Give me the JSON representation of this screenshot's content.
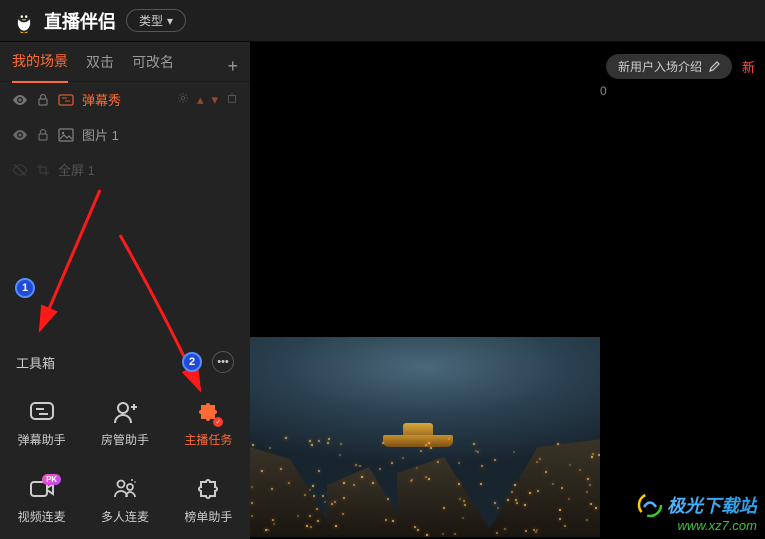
{
  "app": {
    "title": "直播伴侣",
    "dropdown": "类型"
  },
  "tabs": {
    "active": "我的场景",
    "t2": "双击",
    "t3": "可改名"
  },
  "scenes": [
    {
      "name": "弹幕秀",
      "highlighted": true,
      "dim": false
    },
    {
      "name": "图片 1",
      "highlighted": false,
      "dim": false
    },
    {
      "name": "全屏 1",
      "highlighted": false,
      "dim": true
    }
  ],
  "toolbox": {
    "title": "工具箱"
  },
  "tools": {
    "t1": "弹幕助手",
    "t2": "房管助手",
    "t3": "主播任务",
    "t4": "视频连麦",
    "t5": "多人连麦",
    "t6": "榜单助手",
    "pk": "PK"
  },
  "topbar": {
    "intro": "新用户入场介绍",
    "alert": "新"
  },
  "counter": "0",
  "watermark": {
    "name": "极光下载站",
    "url": "www.xz7.com"
  }
}
